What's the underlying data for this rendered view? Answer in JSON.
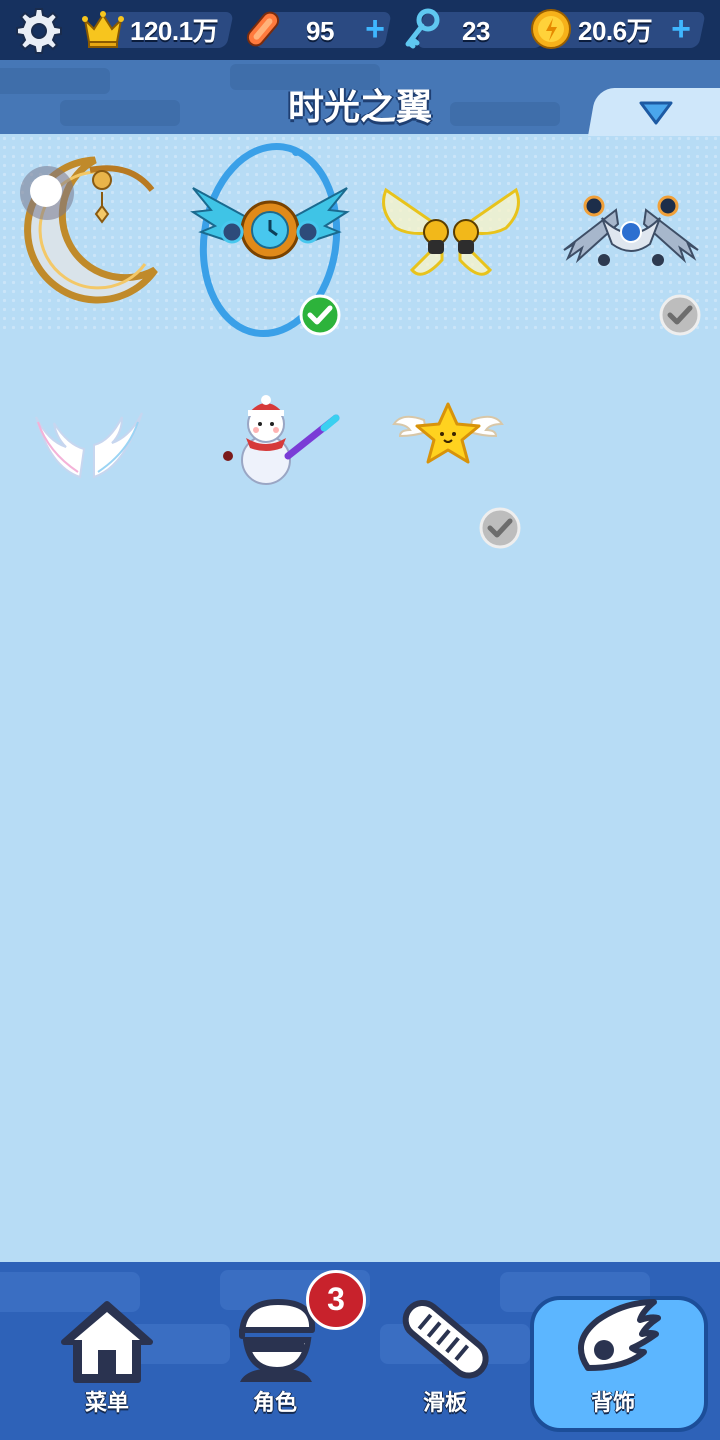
{
  "top_bar": {
    "settings_icon": "gear-icon",
    "currencies": [
      {
        "name": "crown",
        "icon": "crown-icon",
        "value": "120.1万",
        "addable": false
      },
      {
        "name": "board",
        "icon": "skateboard-icon",
        "value": "95",
        "addable": true
      },
      {
        "name": "key",
        "icon": "key-icon",
        "value": "23",
        "addable": true
      },
      {
        "name": "coin",
        "icon": "coin-icon",
        "value": "20.6万",
        "addable": true
      }
    ],
    "plus_label": "+"
  },
  "header": {
    "title": "时光之翼",
    "dropdown_icon": "triangle-down-icon"
  },
  "items": [
    {
      "name": "moon-wing",
      "icon": "crescent-moon-icon",
      "state": "toggle"
    },
    {
      "name": "time-wing",
      "icon": "clockwork-wing-icon",
      "state": "equipped"
    },
    {
      "name": "bee-wing",
      "icon": "golden-butterfly-wing-icon",
      "state": "none"
    },
    {
      "name": "mech-wing",
      "icon": "mechanical-wing-icon",
      "state": "owned"
    },
    {
      "name": "angel-wing",
      "icon": "white-angel-wing-icon",
      "state": "none"
    },
    {
      "name": "snowman",
      "icon": "snowman-icon",
      "state": "none"
    },
    {
      "name": "star-wing",
      "icon": "winged-star-icon",
      "state": "owned"
    }
  ],
  "bottom_nav": {
    "items": [
      {
        "label": "菜单",
        "icon": "house-icon",
        "active": false
      },
      {
        "label": "角色",
        "icon": "character-icon",
        "active": false
      },
      {
        "label": "滑板",
        "icon": "skateboard-icon",
        "active": false
      },
      {
        "label": "背饰",
        "icon": "wing-icon",
        "active": true
      }
    ],
    "badge_count": "3"
  },
  "colors": {
    "background": "#b7dcf5",
    "top_bar": "#16315f",
    "title_bar": "#4677b6",
    "bottom_nav": "#2e62b8",
    "active_nav": "#5cb6ff",
    "equipped_check": "#2db33b",
    "owned_check": "#bdbdbd",
    "badge": "#c8222c"
  }
}
